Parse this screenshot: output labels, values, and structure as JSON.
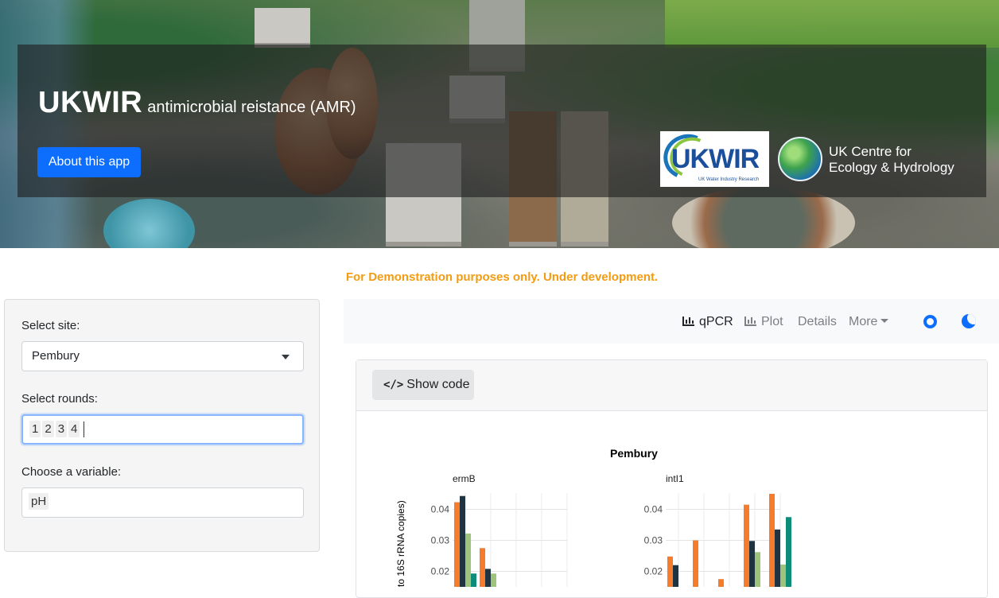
{
  "header": {
    "app_title": "UKWIR",
    "app_subtitle": "antimicrobial reistance (AMR)",
    "about_button": "About this app",
    "logo_ukwir_text": "UKWIR",
    "logo_ukwir_sub": "UK Water Industry Research",
    "ceh_line1": "UK Centre for",
    "ceh_line2": "Ecology & Hydrology"
  },
  "notice": "For Demonstration purposes only. Under development.",
  "sidebar": {
    "site_label": "Select site:",
    "site_value": "Pembury",
    "rounds_label": "Select rounds:",
    "rounds": [
      "1",
      "2",
      "3",
      "4"
    ],
    "variable_label": "Choose a variable:",
    "variable_value": "pH"
  },
  "nav": {
    "items": [
      {
        "label": "qPCR",
        "icon": "bar-chart-icon",
        "active": true
      },
      {
        "label": "Plot",
        "icon": "bar-chart-icon",
        "active": false
      },
      {
        "label": "Details",
        "active": false
      },
      {
        "label": "More",
        "active": false
      }
    ],
    "icons": [
      "github-icon",
      "moon-icon"
    ]
  },
  "card": {
    "show_code": "Show code"
  },
  "colors": {
    "primary": "#0d6efd",
    "notice": "#f39c12",
    "orange": "#f47c2c",
    "navy": "#1f3340",
    "light_green": "#9ec47c",
    "teal": "#0e8c7a"
  },
  "chart_data": {
    "type": "bar",
    "title": "Pembury",
    "ylabel": "to 16S rRNA copies)",
    "panels": [
      {
        "name": "ermB",
        "yticks": [
          0.02,
          0.03,
          0.04
        ],
        "groups": [
          {
            "values": [
              0.0423,
              0.0443,
              0.0322,
              0.0193
            ]
          },
          {
            "values": [
              0.0275,
              0.0208,
              0.0193
            ]
          }
        ]
      },
      {
        "name": "intI1",
        "yticks": [
          0.02,
          0.03,
          0.04
        ],
        "groups": [
          {
            "values": [
              0.0248,
              0.022
            ]
          },
          {
            "values": [
              0.03
            ]
          },
          {
            "values": [
              0.0175
            ]
          },
          {
            "values": [
              0.0415,
              0.0298,
              0.0262
            ]
          },
          {
            "values": [
              0.045,
              0.0335,
              0.0222,
              0.0375
            ]
          }
        ]
      }
    ]
  }
}
